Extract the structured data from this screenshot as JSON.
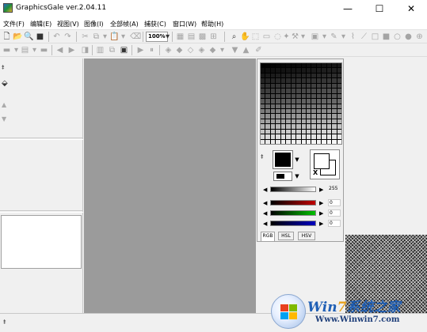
{
  "window": {
    "title": "GraphicsGale ver.2.04.11",
    "minimize": "—",
    "maximize": "☐",
    "close": "✕"
  },
  "menu": [
    "文件(F)",
    "编辑(E)",
    "视图(V)",
    "图像(I)",
    "全部帧(A)",
    "捕获(C)",
    "窗口(W)",
    "帮助(H)"
  ],
  "toolbar": {
    "zoom_value": "100%"
  },
  "color_panel": {
    "gray_value": "255",
    "red_value": "0",
    "green_value": "0",
    "blue_value": "0",
    "bg_marker": "X",
    "tabs": [
      "RGB",
      "HSL",
      "HSV"
    ],
    "active_tab": "RGB",
    "accent_colors": {
      "red": "#c00000",
      "green": "#00c000",
      "blue": "#0000c0"
    }
  },
  "watermark": {
    "brand_prefix": "Win",
    "brand_seven": "7",
    "brand_suffix": "系统之家",
    "url": "Www.Winwin7.com"
  }
}
